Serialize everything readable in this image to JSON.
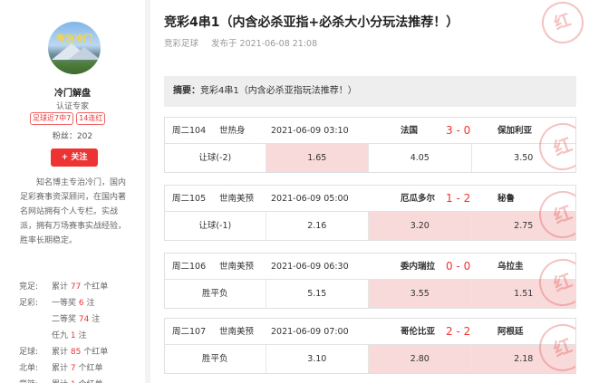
{
  "profile": {
    "avatar_text_a": "专治",
    "avatar_text_b": "冷门",
    "name": "冷门解盘",
    "title": "认证专家",
    "badge_recent": "足球近7中7",
    "badge_streak": "14连红",
    "fans_label": "粉丝：",
    "fans_count": "202",
    "follow_label": "+ 关注",
    "bio": "知名博主专治冷门，国内足彩赛事资深顾问，在国内著名网站拥有个人专栏。实战派，拥有万场赛事实战经验，胜率长期稳定。"
  },
  "records": [
    {
      "k": "竞足:",
      "pre": "累计",
      "n": "77",
      "post": "个红单"
    },
    {
      "k": "足彩:",
      "pre": "一等奖",
      "n": "6",
      "post": "注"
    },
    {
      "k": "",
      "pre": "二等奖",
      "n": "74",
      "post": "注"
    },
    {
      "k": "",
      "pre": "任九",
      "n": "1",
      "post": "注"
    },
    {
      "k": "足球:",
      "pre": "累计",
      "n": "85",
      "post": "个红单"
    },
    {
      "k": "北单:",
      "pre": "累计",
      "n": "7",
      "post": "个红单"
    },
    {
      "k": "竞篮:",
      "pre": "累计",
      "n": "1",
      "post": "个红单"
    }
  ],
  "article": {
    "title": "竞彩4串1（内含必杀亚指+必杀大小分玩法推荐！）",
    "category": "竞彩足球",
    "published": "发布于 2021-06-08 21:08",
    "summary_label": "摘要：",
    "summary_text": "竞彩4串1（内含必杀亚指玩法推荐！）",
    "stamp": "红"
  },
  "matches": [
    {
      "code": "周二104",
      "league": "世热身",
      "time": "2021-06-09 03:10",
      "home": "法国",
      "score": "3 - 0",
      "away": "保加利亚",
      "type": "让球(-2)",
      "odds": [
        "1.65",
        "4.05",
        "3.50"
      ],
      "hl": [
        true,
        false,
        false
      ]
    },
    {
      "code": "周二105",
      "league": "世南美预",
      "time": "2021-06-09 05:00",
      "home": "厄瓜多尔",
      "score": "1 - 2",
      "away": "秘鲁",
      "type": "让球(-1)",
      "odds": [
        "2.16",
        "3.20",
        "2.75"
      ],
      "hl": [
        false,
        true,
        true
      ]
    },
    {
      "code": "周二106",
      "league": "世南美预",
      "time": "2021-06-09 06:30",
      "home": "委内瑞拉",
      "score": "0 - 0",
      "away": "乌拉圭",
      "type": "胜平负",
      "odds": [
        "5.15",
        "3.55",
        "1.51"
      ],
      "hl": [
        false,
        true,
        true
      ]
    },
    {
      "code": "周二107",
      "league": "世南美预",
      "time": "2021-06-09 07:00",
      "home": "哥伦比亚",
      "score": "2 - 2",
      "away": "阿根廷",
      "type": "胜平负",
      "odds": [
        "3.10",
        "2.80",
        "2.18"
      ],
      "hl": [
        false,
        true,
        true
      ]
    }
  ]
}
